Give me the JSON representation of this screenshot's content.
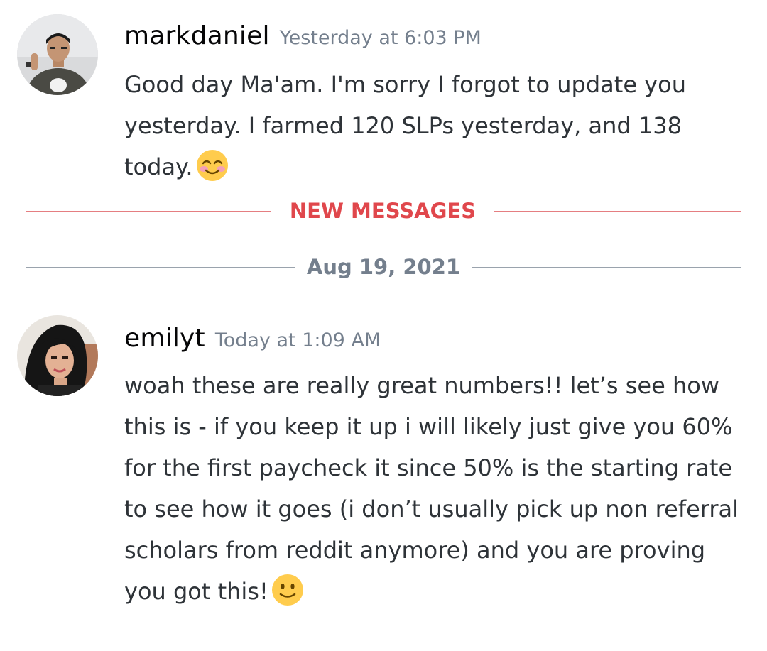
{
  "messages": [
    {
      "username": "markdaniel",
      "timestamp": "Yesterday at 6:03 PM",
      "text": "Good day Ma'am. I'm sorry I forgot to update you yesterday. I farmed 120 SLPs yesterday, and 138 today.",
      "emoji": "smiling-face-with-smiling-eyes-icon"
    },
    {
      "username": "emilyt",
      "timestamp": "Today at 1:09 AM",
      "text": "woah these are really great numbers!! let’s see how this is - if you keep it up i will likely just give you 60% for the first paycheck it since 50% is the starting rate to see how it goes (i don’t usually pick up non referral scholars from reddit anymore) and you are proving you got this!",
      "emoji": "slightly-smiling-face-icon"
    }
  ],
  "dividers": {
    "new_messages": "NEW MESSAGES",
    "date": "Aug 19, 2021"
  },
  "colors": {
    "new_messages_accent": "#e0474c",
    "timestamp": "#747f8d",
    "username": "#060607",
    "message_text": "#2e3338"
  }
}
